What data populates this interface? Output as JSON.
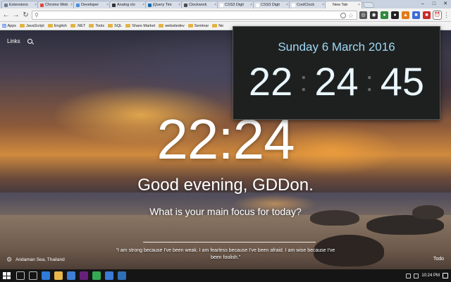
{
  "browser": {
    "tabs": [
      {
        "label": "Extensions",
        "favicon_color": "#6b7b93",
        "active": false
      },
      {
        "label": "Chrome Web",
        "favicon_color": "#e0493d",
        "active": false
      },
      {
        "label": "Developer",
        "favicon_color": "#4a90d9",
        "active": false
      },
      {
        "label": "Analog clo",
        "favicon_color": "#333333",
        "active": false
      },
      {
        "label": "jQuery Tim",
        "favicon_color": "#1769aa",
        "active": false
      },
      {
        "label": "Clockwork",
        "favicon_color": "#4c4c4c",
        "active": false
      },
      {
        "label": "CSS3 Digit",
        "favicon_color": "#ffffff",
        "active": false
      },
      {
        "label": "CSS3 Digit",
        "favicon_color": "#ffffff",
        "active": false
      },
      {
        "label": "CoolClock",
        "favicon_color": "#ffffff",
        "active": false
      },
      {
        "label": "New Tab",
        "favicon_color": "#f2f2f2",
        "active": true
      }
    ],
    "window_controls": [
      "–",
      "□",
      "✕"
    ],
    "address": {
      "value": "",
      "placeholder": ""
    },
    "extensions": [
      {
        "name": "search-ext-icon",
        "color": "#5a5a5a",
        "glyph": "◎"
      },
      {
        "name": "eye-ext-icon",
        "color": "#333333",
        "glyph": "◉"
      },
      {
        "name": "chrome-ext-icon",
        "color": "#2f8a3b",
        "glyph": "●"
      },
      {
        "name": "dark-ext-icon",
        "color": "#222222",
        "glyph": "●"
      },
      {
        "name": "orange-ext-icon",
        "color": "#e07b1a",
        "glyph": "▲"
      },
      {
        "name": "blue-ext-icon",
        "color": "#3b6bd6",
        "glyph": "■"
      },
      {
        "name": "red-ext-icon",
        "color": "#c92a2a",
        "glyph": "■"
      },
      {
        "name": "clock-ext-icon",
        "color": "#ffffff",
        "glyph": "⏰"
      }
    ],
    "bookmarks": [
      {
        "label": "Apps",
        "kind": "apps"
      },
      {
        "label": "JavaScript",
        "kind": "folder"
      },
      {
        "label": "English",
        "kind": "folder"
      },
      {
        "label": ".NET",
        "kind": "folder"
      },
      {
        "label": "Tools",
        "kind": "folder"
      },
      {
        "label": "SQL",
        "kind": "folder"
      },
      {
        "label": "Share Market",
        "kind": "folder"
      },
      {
        "label": "websitedev",
        "kind": "folder"
      },
      {
        "label": "Seminar",
        "kind": "folder"
      },
      {
        "label": "Ne",
        "kind": "folder"
      }
    ]
  },
  "newtab": {
    "links_label": "Links",
    "clock": "22:24",
    "greeting": "Good evening, GDDon.",
    "focus_question": "What is your main focus for today?",
    "location": "Andaman Sea, Thailand",
    "quote": "“I am strong because I've been weak. I am fearless because I've been afraid. I am wise because I've been foolish.”",
    "todo_label": "Todo"
  },
  "popup": {
    "date": "Sunday 6 March 2016",
    "hours": "22",
    "minutes": "24",
    "seconds": "45",
    "separator": ":"
  },
  "taskbar": {
    "apps": [
      {
        "name": "search-taskbar-icon",
        "color": "#151515"
      },
      {
        "name": "task-view-icon",
        "color": "#151515"
      },
      {
        "name": "edge-icon",
        "color": "#2f7bd6"
      },
      {
        "name": "file-explorer-icon",
        "color": "#e8b84a"
      },
      {
        "name": "store-icon",
        "color": "#3f7fd6"
      },
      {
        "name": "visual-studio-icon",
        "color": "#68217a"
      },
      {
        "name": "chrome-icon",
        "color": "#34a853"
      },
      {
        "name": "windows-icon",
        "color": "#3b7ad6"
      },
      {
        "name": "photos-icon",
        "color": "#2f6fb8"
      }
    ],
    "time": "10:24 PM"
  }
}
